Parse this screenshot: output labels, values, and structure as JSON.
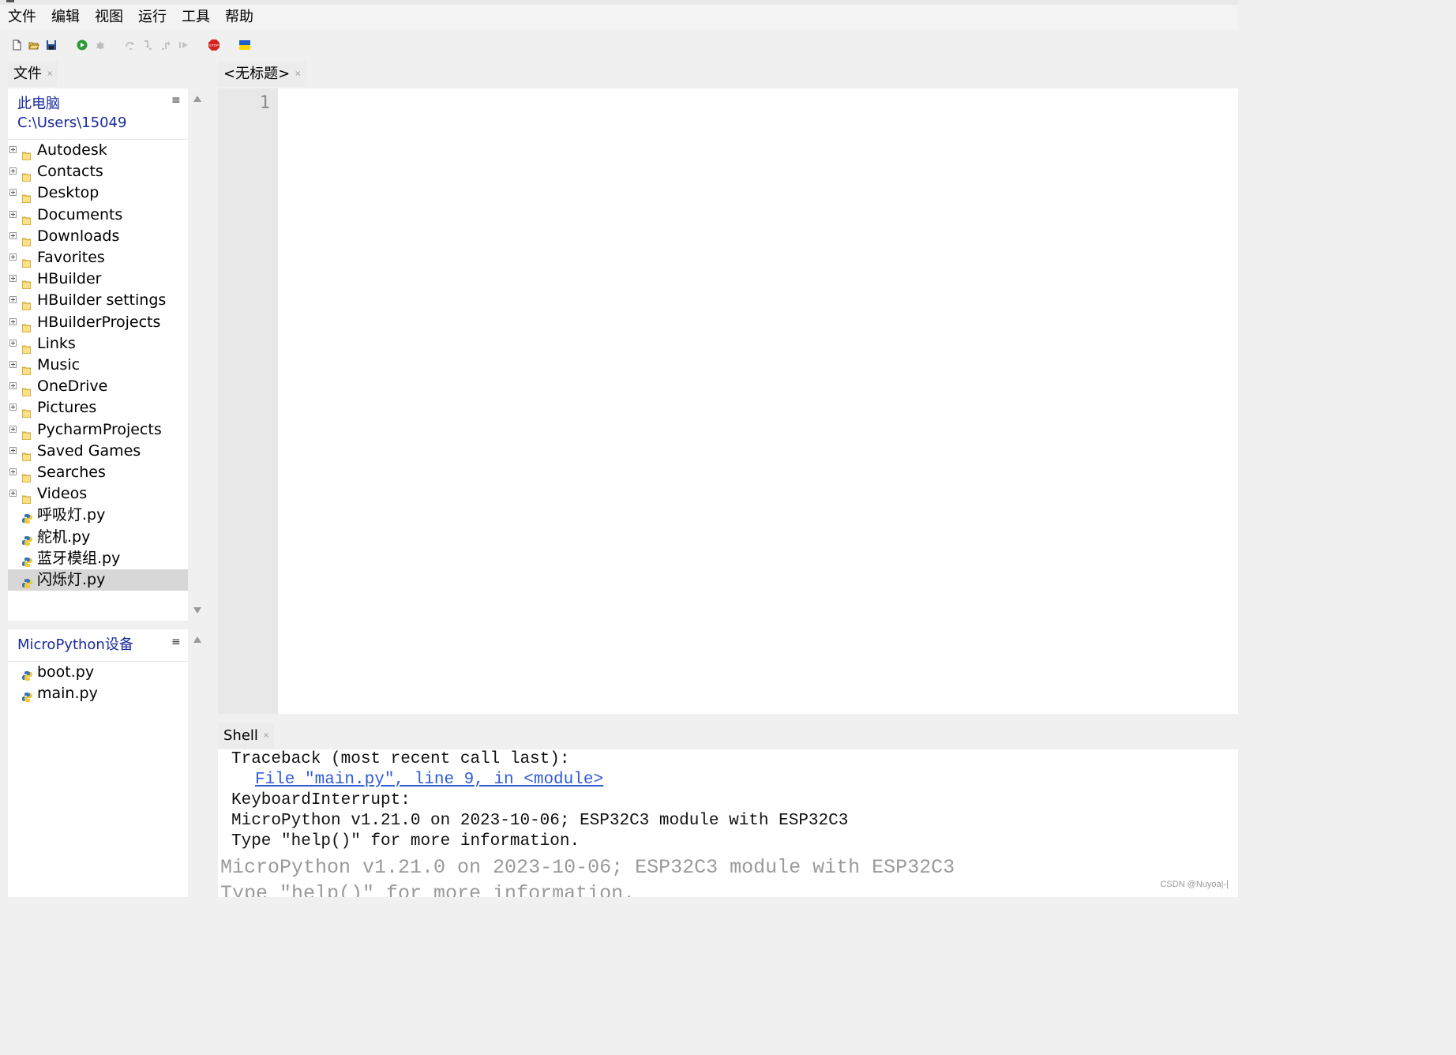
{
  "menu": [
    "文件",
    "编辑",
    "视图",
    "运行",
    "工具",
    "帮助"
  ],
  "toolbar": [
    {
      "icon": "new-file-icon"
    },
    {
      "icon": "open-folder-icon"
    },
    {
      "icon": "save-icon"
    },
    {
      "icon": "run-icon"
    },
    {
      "icon": "debug-icon"
    },
    {
      "icon": "step-over-icon"
    },
    {
      "icon": "step-into-icon"
    },
    {
      "icon": "step-out-icon"
    },
    {
      "icon": "resume-icon"
    },
    {
      "icon": "stop-icon",
      "text": "STOP"
    },
    {
      "icon": "ukraine-flag-icon"
    }
  ],
  "files_tab": {
    "label": "文件"
  },
  "files_panel": {
    "location": "此电脑",
    "path": "C:\\Users\\15049",
    "folders": [
      "Autodesk",
      "Contacts",
      "Desktop",
      "Documents",
      "Downloads",
      "Favorites",
      "HBuilder",
      "HBuilder settings",
      "HBuilderProjects",
      "Links",
      "Music",
      "OneDrive",
      "Pictures",
      "PycharmProjects",
      "Saved Games",
      "Searches",
      "Videos"
    ],
    "files": [
      "呼吸灯.py",
      "舵机.py",
      "蓝牙模组.py",
      "闪烁灯.py"
    ],
    "selected_file": "闪烁灯.py"
  },
  "device_panel": {
    "title": "MicroPython设备",
    "files": [
      "boot.py",
      "main.py"
    ]
  },
  "editor": {
    "tab_label": "<无标题>",
    "line_number": "1"
  },
  "shell": {
    "tab_label": "Shell",
    "traceback": "Traceback (most recent call last):",
    "file_link": "File \"main.py\", line 9, in <module>",
    "interrupt": "KeyboardInterrupt:",
    "banner": "MicroPython v1.21.0 on 2023-10-06; ESP32C3 module with ESP32C3",
    "help_hint": "Type \"help()\" for more information.",
    "banner_dim": "MicroPython v1.21.0 on 2023-10-06; ESP32C3 module with ESP32C3",
    "help_hint_dim": "Type \"help()\" for more information."
  },
  "watermark": "CSDN @Nuyoa|-|",
  "colors": {
    "panel_heading": "#1a2a9e",
    "link": "#2f5bd6",
    "selection": "#d7d7d7"
  }
}
